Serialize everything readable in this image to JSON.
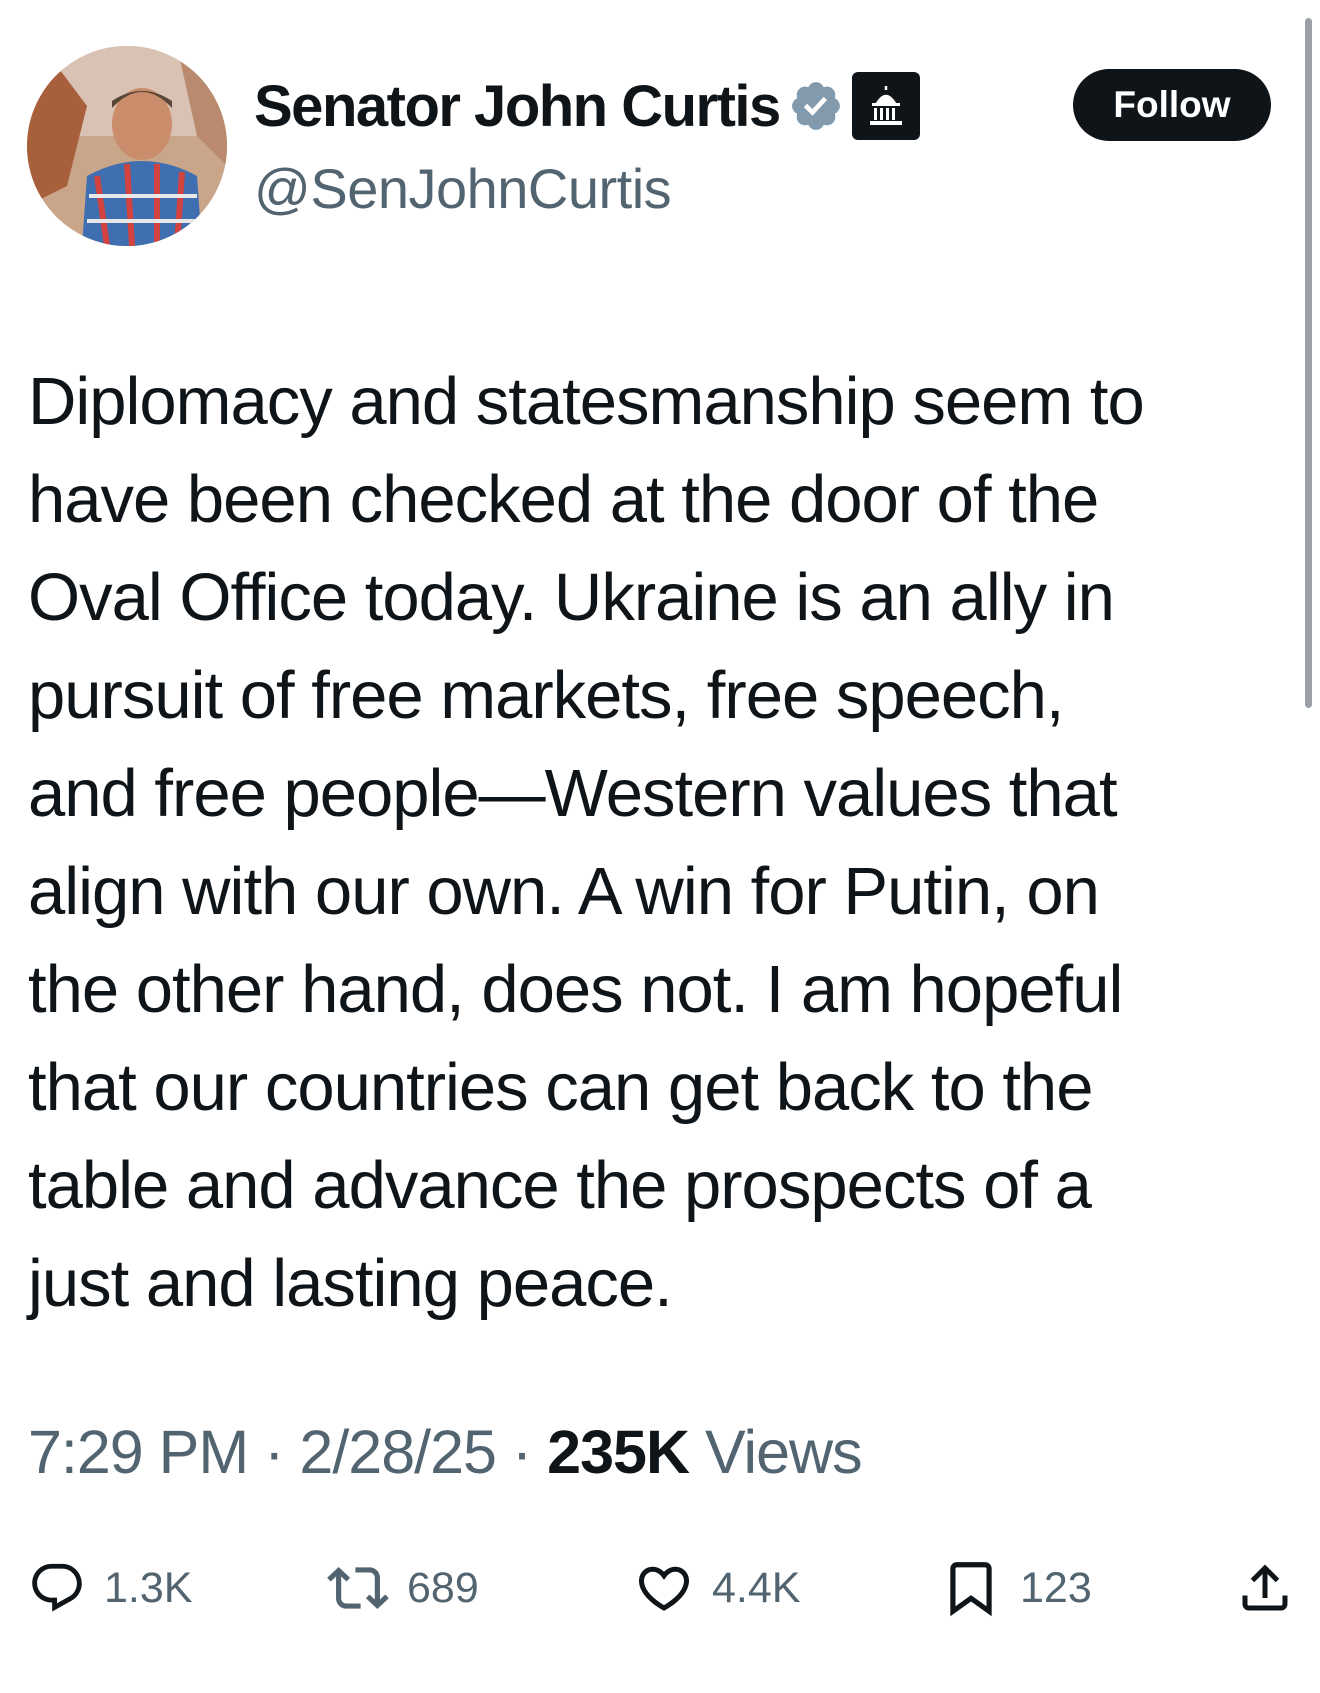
{
  "profile": {
    "display_name": "Senator John Curtis",
    "handle": "@SenJohnCurtis",
    "follow_label": "Follow"
  },
  "tweet": {
    "text": "Diplomacy and statesmanship seem to\nhave been checked at the door of the\nOval Office today. Ukraine is an ally in\npursuit of free markets, free speech,\nand free people—Western values that\nalign with our own. A win for Putin, on\nthe other hand, does not. I am hopeful\nthat our countries can get back to the\ntable and advance the prospects of a\njust and lasting peace.",
    "time": "7:29 PM",
    "date": "2/28/25",
    "separator": "·",
    "views_count": "235K",
    "views_label": "Views"
  },
  "actions": {
    "replies": "1.3K",
    "reposts": "689",
    "likes": "4.4K",
    "bookmarks": "123"
  },
  "icons": {
    "verified": "verified-badge-icon",
    "affiliation": "government-building-icon",
    "reply": "reply-icon",
    "repost": "repost-icon",
    "like": "heart-icon",
    "bookmark": "bookmark-icon",
    "share": "share-icon"
  },
  "colors": {
    "text_primary": "#0f1419",
    "text_secondary": "#536471",
    "follow_background": "#0f1419",
    "verified_badge": "#829aab"
  }
}
